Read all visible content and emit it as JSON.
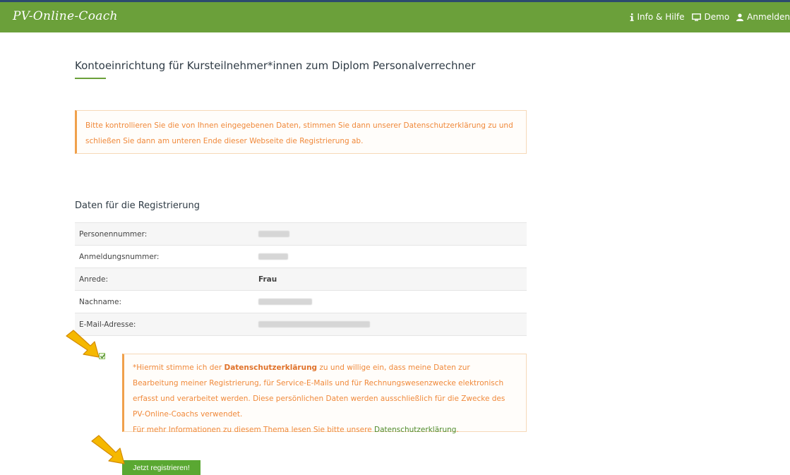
{
  "navbar": {
    "brand": "PV-Online-Coach",
    "links": [
      {
        "label": "Info & Hilfe",
        "icon": "info-icon"
      },
      {
        "label": "Demo",
        "icon": "monitor-icon"
      },
      {
        "label": "Anmelden",
        "icon": "user-icon"
      }
    ]
  },
  "page": {
    "title": "Kontoeinrichtung für Kursteilnehmer*innen zum Diplom Personalverrechner"
  },
  "notice": {
    "text": "Bitte kontrollieren Sie die von Ihnen eingegebenen Daten, stimmen Sie dann unserer Datenschutzerklärung zu und schließen Sie dann am unteren Ende dieser Webseite die Registrierung ab."
  },
  "registration": {
    "title": "Daten für die Registrierung",
    "rows": [
      {
        "label": "Personennummer:",
        "value": "",
        "redacted": true
      },
      {
        "label": "Anmeldungsnummer:",
        "value": "",
        "redacted": true
      },
      {
        "label": "Anrede:",
        "value": "Frau",
        "redacted": false
      },
      {
        "label": "Nachname:",
        "value": "",
        "redacted": true
      },
      {
        "label": "E-Mail-Adresse:",
        "value": "",
        "redacted": true
      }
    ]
  },
  "consent": {
    "checked": true,
    "prefix": "*Hiermit stimme ich der ",
    "link1": "Datenschutzerklärung",
    "middle": " zu und willige ein, dass meine Daten zur Bearbeitung meiner Registrierung, für Service-E-Mails und für Rechnungswesenzwecke elektronisch erfasst und verarbeitet werden. Diese persönlichen Daten werden ausschließlich für die Zwecke des PV-Online-Coachs verwendet.",
    "line4_prefix": "Für mehr Informationen zu diesem Thema lesen Sie bitte unsere ",
    "link2": "Datenschutzerklärung",
    "line4_suffix": "."
  },
  "register_button": {
    "label": "Jetzt registrieren!"
  },
  "colors": {
    "navbar": "#6ba03a",
    "accent_orange": "#f0893a",
    "button_green": "#5aa832",
    "annotation_arrow": "#f5b800"
  }
}
